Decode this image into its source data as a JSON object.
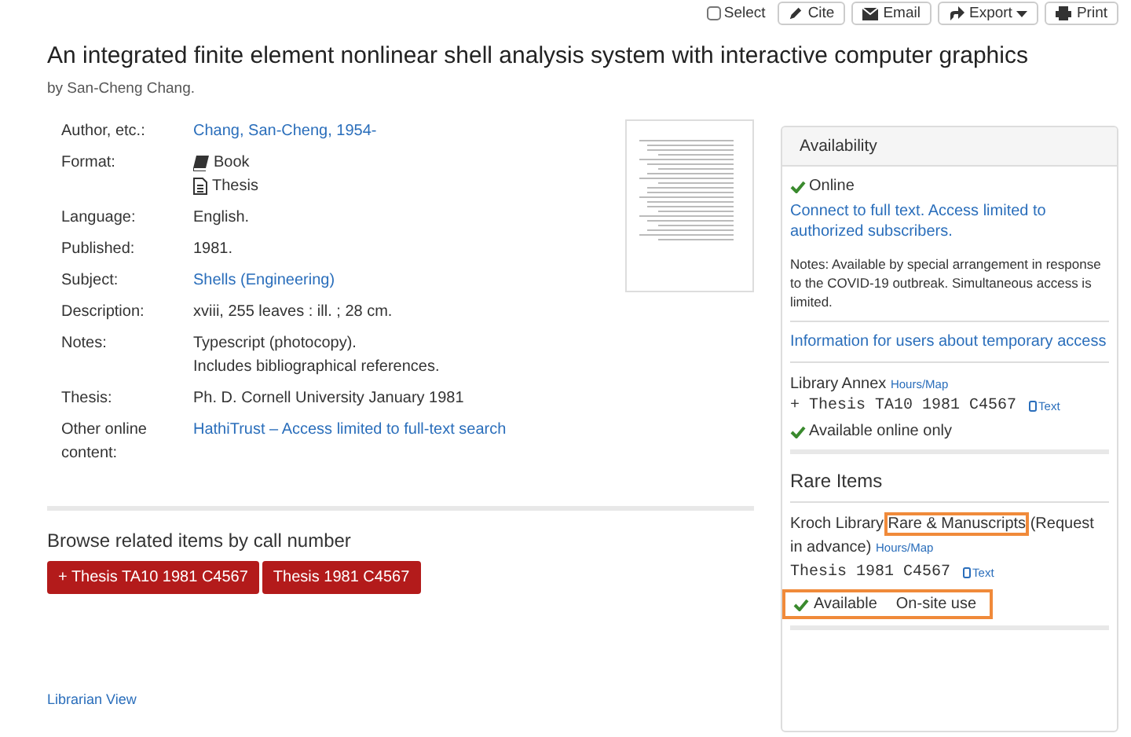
{
  "toolbar": {
    "select": {
      "label": "Select",
      "checked": false
    },
    "buttons": [
      {
        "label": "Cite",
        "caret": false
      },
      {
        "label": "Email",
        "caret": false
      },
      {
        "label": "Export",
        "caret": true
      },
      {
        "label": "Print",
        "caret": false
      }
    ]
  },
  "title": "An integrated finite element nonlinear shell analysis system with interactive computer graphics",
  "byline": "by San-Cheng Chang.",
  "details": [
    {
      "label": "Author, etc.:",
      "values": [
        {
          "kind": "link",
          "text": "Chang, San-Cheng, 1954-"
        }
      ]
    },
    {
      "label": "Format:",
      "values": [
        {
          "kind": "book",
          "text": "Book"
        },
        {
          "kind": "document",
          "text": "Thesis"
        }
      ]
    },
    {
      "label": "Language:",
      "values": [
        {
          "kind": "text",
          "text": "English."
        }
      ]
    },
    {
      "label": "Published:",
      "values": [
        {
          "kind": "text",
          "text": "1981."
        }
      ]
    },
    {
      "label": "Subject:",
      "values": [
        {
          "kind": "link",
          "text": "Shells (Engineering)"
        }
      ]
    },
    {
      "label": "Description:",
      "values": [
        {
          "kind": "text",
          "text": "xviii, 255 leaves : ill. ; 28 cm."
        }
      ]
    },
    {
      "label": "Notes:",
      "values": [
        {
          "kind": "text",
          "text": "Typescript (photocopy)."
        },
        {
          "kind": "text",
          "text": "Includes bibliographical references."
        }
      ]
    },
    {
      "label": "Thesis:",
      "values": [
        {
          "kind": "text",
          "text": "Ph. D. Cornell University January 1981"
        }
      ]
    },
    {
      "label": "Other online content:",
      "values": [
        {
          "kind": "link",
          "text": "HathiTrust – Access limited to full-text search"
        }
      ]
    }
  ],
  "browse": {
    "heading": "Browse related items by call number",
    "buttons": [
      "+ Thesis TA10 1981 C4567",
      "Thesis 1981 C4567"
    ]
  },
  "librarian_view": "Librarian View",
  "availability": {
    "header": "Availability",
    "online": {
      "status": "Online",
      "link": "Connect to full text. Access limited to authorized subscribers.",
      "notes": "Notes: Available by special arrangement in response to the COVID-19 outbreak. Simultaneous access is limited.",
      "info_link": "Information for users about temporary access"
    },
    "annex": {
      "location": "Library Annex",
      "hours": "Hours/Map",
      "call_number": "+ Thesis TA10 1981 C4567",
      "text_link": "Text",
      "status": "Available online only"
    },
    "rare": {
      "heading": "Rare Items",
      "location": "Kroch Library",
      "location_link": {
        "text": "Rare & Manuscripts",
        "highlighted": true
      },
      "location_note": "(Request in advance)",
      "hours": "Hours/Map",
      "call_number": "Thesis 1981 C4567",
      "text_link": "Text",
      "status": "Available",
      "status_note": "On-site use",
      "status_highlighted": true
    }
  }
}
